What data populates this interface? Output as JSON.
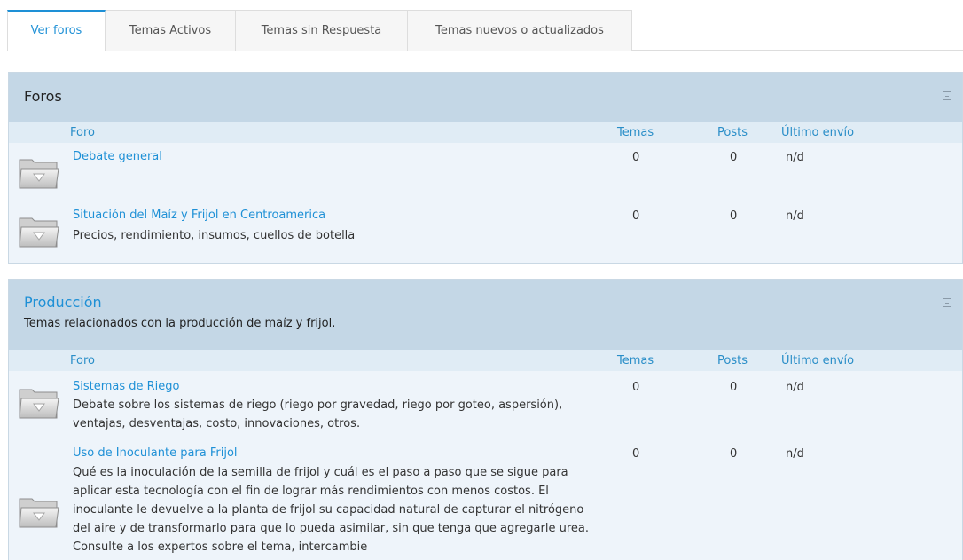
{
  "tabs": [
    {
      "label": "Ver foros",
      "active": true
    },
    {
      "label": "Temas Activos",
      "active": false
    },
    {
      "label": "Temas sin Respuesta",
      "active": false
    },
    {
      "label": "Temas nuevos o actualizados",
      "active": false
    }
  ],
  "columns": {
    "forum": "Foro",
    "topics": "Temas",
    "posts": "Posts",
    "last": "Último envío"
  },
  "categories": [
    {
      "title": "Foros",
      "forums": [
        {
          "title": "Debate general",
          "description": "",
          "topics": "0",
          "posts": "0",
          "last": "n/d"
        },
        {
          "title": "Situación del Maíz y Frijol en Centroamerica",
          "description": "Precios, rendimiento, insumos, cuellos de botella",
          "topics": "0",
          "posts": "0",
          "last": "n/d"
        }
      ]
    },
    {
      "title": "Producción",
      "description": "Temas relacionados con la producción de maíz y frijol.",
      "forums": [
        {
          "title": "Sistemas de Riego",
          "description": "Debate sobre los sistemas de riego (riego por gravedad, riego por goteo, aspersión), ventajas, desventajas, costo, innovaciones, otros.",
          "topics": "0",
          "posts": "0",
          "last": "n/d"
        },
        {
          "title": "Uso de Inoculante para Frijol",
          "description": "Qué es la inoculación de la semilla de frijol y cuál es el paso a paso que se sigue para aplicar esta tecnología con el fin de lograr más rendimientos con menos costos. El inoculante le devuelve a la planta de frijol su capacidad natural de capturar el nitrógeno del aire y de transformarlo para que lo pueda asimilar, sin que tenga que agregarle urea. Consulte a los expertos sobre el tema, intercambie",
          "topics": "0",
          "posts": "0",
          "last": "n/d"
        }
      ]
    }
  ],
  "icons": {
    "forum_folder": "folder-icon",
    "collapse": "collapse-icon"
  },
  "colors": {
    "accent": "#1e90d6",
    "header_bg": "#c4d7e6",
    "row_bg": "#eef4fa"
  }
}
